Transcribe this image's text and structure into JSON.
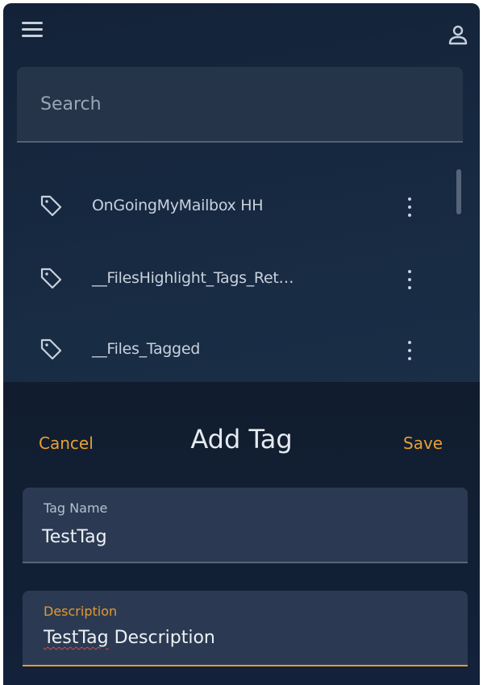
{
  "topbar": {
    "menu_icon": "hamburger-menu-icon",
    "profile_icon": "user-profile-icon"
  },
  "search": {
    "placeholder": "Search",
    "value": ""
  },
  "tags": [
    {
      "label": "OnGoingMyMailbox HH",
      "icon": "tag-icon"
    },
    {
      "label": "__FilesHighlight_Tags_Ret…",
      "icon": "tag-icon"
    },
    {
      "label": "__Files_Tagged",
      "icon": "tag-icon"
    }
  ],
  "sheet": {
    "cancel_label": "Cancel",
    "title": "Add Tag",
    "save_label": "Save",
    "fields": {
      "name": {
        "label": "Tag Name",
        "value": "TestTag"
      },
      "description": {
        "label": "Description",
        "value_misspelled": "TestTag",
        "value_rest": " Description"
      }
    }
  },
  "colors": {
    "accent": "#e8a035",
    "background": "#182c44",
    "field_background": "#2b3a52",
    "text": "#eef1f5"
  }
}
